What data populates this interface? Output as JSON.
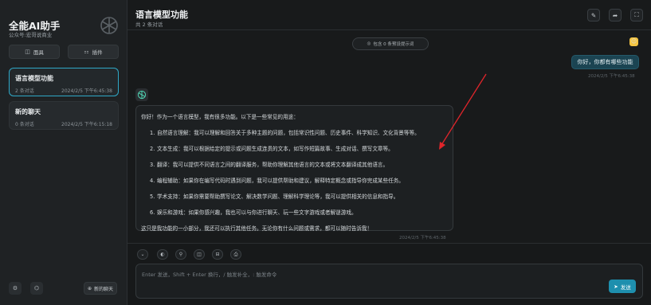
{
  "sidebar": {
    "title": "全能AI助手",
    "subtitle": "公众号:宏哥说商业",
    "buttons": [
      {
        "label": "面具",
        "icon": "mask-icon"
      },
      {
        "label": "插件",
        "icon": "plugin-icon"
      }
    ],
    "chats": [
      {
        "title": "语言模型功能",
        "count": "2 条对话",
        "date": "2024/2/5 下午6:45:38",
        "active": true
      },
      {
        "title": "新的聊天",
        "count": "0 条对话",
        "date": "2024/2/5 下午6:15:18",
        "active": false
      }
    ],
    "new_chat_label": "新的聊天"
  },
  "header": {
    "title": "语言模型功能",
    "count": "共 2 条对话"
  },
  "pill": {
    "label": "包含 0 条预设提示词"
  },
  "messages": {
    "user_text": "你好，你都有哪些功能",
    "user_time": "2024/2/5 下午6:45:38",
    "ai_intro": "你好！作为一个语言模型，我有很多功能。以下是一些常见的用途：",
    "ai_items": [
      {
        "num": "1.",
        "text": "自然语言理解：我可以理解和回答关于多种主题的问题，包括常识性问题、历史事件、科学知识、文化背景等等。"
      },
      {
        "num": "2.",
        "text": "文本生成：我可以根据给定的提示或问题生成连贯的文本，如写作短篇故事、生成对话、撰写文章等。"
      },
      {
        "num": "3.",
        "text": "翻译：我可以提供不同语言之间的翻译服务，帮助你理解其他语言的文本或将文本翻译成其他语言。"
      },
      {
        "num": "4.",
        "text": "编程辅助：如果你在编写代码时遇到问题，我可以提供帮助和建议，解释特定概念或指导你完成某些任务。"
      },
      {
        "num": "5.",
        "text": "学术支持：如果你需要帮助撰写论文、解决数学问题、理解科学理论等，我可以提供相关的信息和指导。"
      },
      {
        "num": "6.",
        "text": "娱乐和游戏：如果你感兴趣，我也可以与你进行聊天、玩一些文字游戏或者解谜游戏。"
      }
    ],
    "ai_outro": "这只是我功能的一小部分，我还可以执行其他任务。无论你有什么问题或需求，都可以随时告诉我！",
    "ai_time": "2024/2/5 下午6:45:38"
  },
  "input": {
    "placeholder": "Enter 发送，Shift + Enter 换行，/ 触发补全，: 触发命令",
    "send_label": "发送"
  },
  "colors": {
    "accent": "#1e8fae",
    "active_border": "#2fa8c7",
    "annotation_arrow": "#e0252b"
  }
}
